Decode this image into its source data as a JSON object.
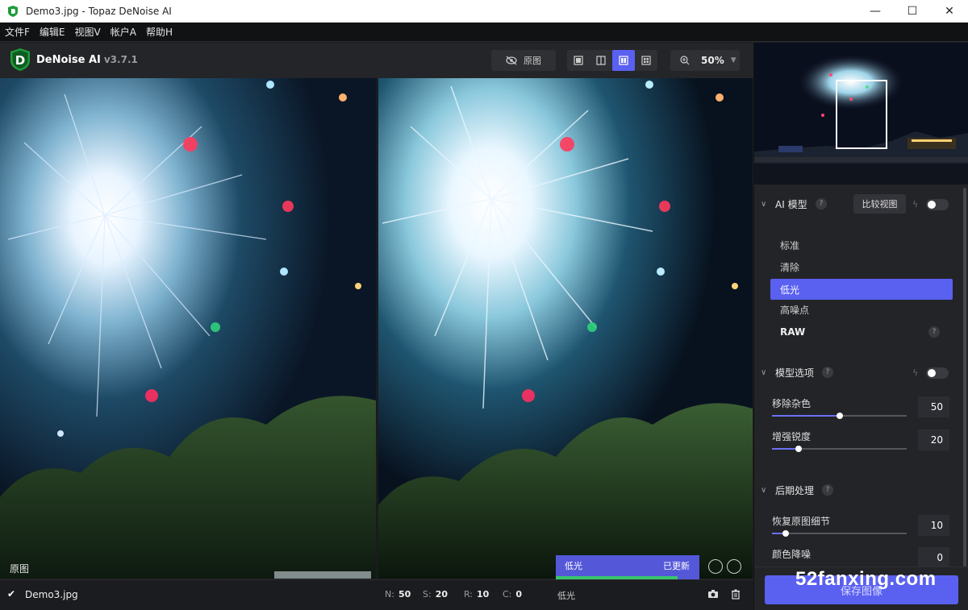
{
  "window": {
    "title": "Demo3.jpg - Topaz DeNoise AI",
    "controls": {
      "minimize": "—",
      "maximize": "☐",
      "close": "✕"
    }
  },
  "menu": [
    "文件F",
    "编辑E",
    "视图V",
    "帐户A",
    "帮助H"
  ],
  "app": {
    "name": "DeNoise AI",
    "version": "v3.7.1",
    "logo_letter": "D"
  },
  "toolbar": {
    "original_label": "原图",
    "zoom": "50%"
  },
  "view": {
    "left_label": "原图"
  },
  "status": {
    "model": "低光",
    "state": "已更新",
    "progress": 0.85
  },
  "bottom": {
    "filename": "Demo3.jpg",
    "stats": [
      {
        "key": "N:",
        "value": "50"
      },
      {
        "key": "S:",
        "value": "20"
      },
      {
        "key": "R:",
        "value": "10"
      },
      {
        "key": "C:",
        "value": "0"
      }
    ],
    "model": "低光"
  },
  "sidebar": {
    "ai_model": {
      "title": "AI 模型",
      "help": "?",
      "compare_label": "比较视图",
      "bolt": "ϟ",
      "items": [
        "标准",
        "清除",
        "低光",
        "高噪点",
        "RAW"
      ],
      "selected": "低光"
    },
    "model_options": {
      "title": "模型选项",
      "help": "?",
      "bolt": "ϟ",
      "sliders": [
        {
          "label": "移除杂色",
          "value": "50",
          "level": 0.5
        },
        {
          "label": "增强锐度",
          "value": "20",
          "level": 0.2
        }
      ]
    },
    "post": {
      "title": "后期处理",
      "help": "?",
      "sliders": [
        {
          "label": "恢复原图细节",
          "value": "10",
          "level": 0.1
        },
        {
          "label": "颜色降噪",
          "value": "0",
          "level": 0.0
        }
      ]
    },
    "save_label": "保存图像"
  },
  "watermark": "52fanxing.com",
  "colors": {
    "accent": "#5a60f0",
    "progress": "#39c46b",
    "logo_green": "#1f9d3a"
  }
}
